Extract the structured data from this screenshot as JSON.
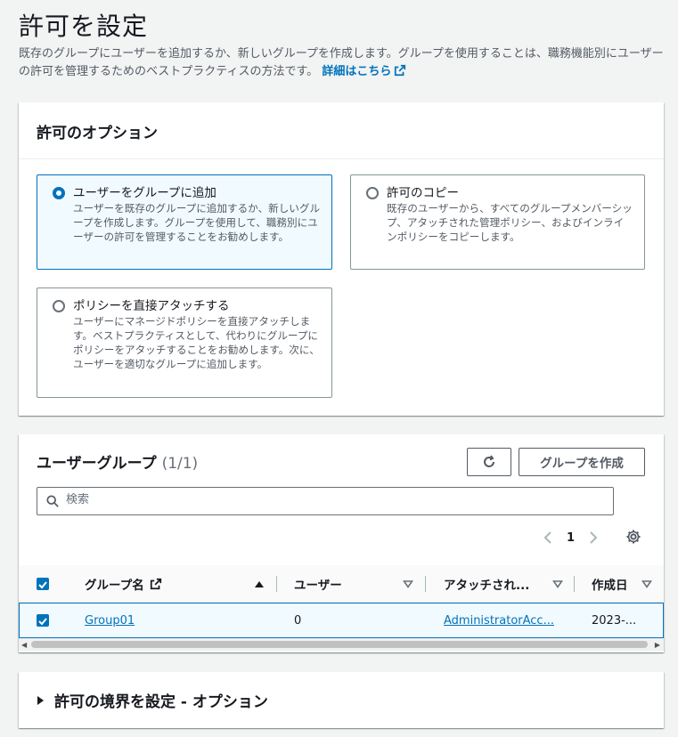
{
  "page": {
    "title": "許可を設定",
    "description": "既存のグループにユーザーを追加するか、新しいグループを作成します。グループを使用することは、職務機能別にユーザーの許可を管理するためのベストプラクティスの方法です。",
    "learn_more": "詳細はこちら"
  },
  "options": {
    "header": "許可のオプション",
    "items": [
      {
        "title": "ユーザーをグループに追加",
        "desc": "ユーザーを既存のグループに追加するか、新しいグループを作成します。グループを使用して、職務別にユーザーの許可を管理することをお勧めします。",
        "selected": true
      },
      {
        "title": "許可のコピー",
        "desc": "既存のユーザーから、すべてのグループメンバーシップ、アタッチされた管理ポリシー、およびインラインポリシーをコピーします。",
        "selected": false
      },
      {
        "title": "ポリシーを直接アタッチする",
        "desc": "ユーザーにマネージドポリシーを直接アタッチします。ベストプラクティスとして、代わりにグループにポリシーをアタッチすることをお勧めします。次に、ユーザーを適切なグループに追加します。",
        "selected": false
      }
    ]
  },
  "groups": {
    "title": "ユーザーグループ",
    "count": "(1/1)",
    "create_button": "グループを作成",
    "search_placeholder": "検索",
    "page": "1",
    "columns": [
      "グループ名",
      "ユーザー",
      "アタッチされ...",
      "作成日"
    ],
    "rows": [
      {
        "name": "Group01",
        "users": "0",
        "policies": "AdministratorAcc...",
        "created": "2023-..."
      }
    ]
  },
  "boundary": {
    "title": "許可の境界を設定 - オプション"
  },
  "colors": {
    "accent": "#0073bb",
    "text": "#16191f",
    "muted": "#545b64"
  }
}
